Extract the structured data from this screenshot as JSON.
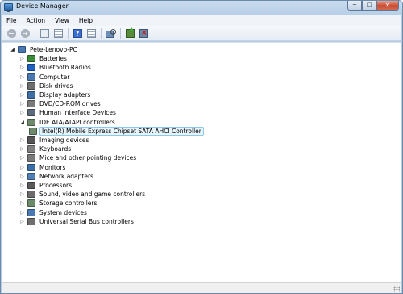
{
  "window": {
    "title": "Device Manager"
  },
  "menu": [
    "File",
    "Action",
    "View",
    "Help"
  ],
  "toolbar": {
    "buttons": [
      "back-icon",
      "forward-icon",
      "show-hide-tree-icon",
      "properties-icon",
      "help-icon",
      "view-icon",
      "scan-hardware-icon",
      "update-driver-icon",
      "uninstall-icon"
    ]
  },
  "tree": {
    "root": "Pete-Lenovo-PC",
    "items": [
      {
        "label": "Batteries",
        "icon": "battery-icon",
        "color": "#3a8a3a"
      },
      {
        "label": "Bluetooth Radios",
        "icon": "bluetooth-icon",
        "color": "#1e5fc0"
      },
      {
        "label": "Computer",
        "icon": "computer-icon",
        "color": "#4a78b0"
      },
      {
        "label": "Disk drives",
        "icon": "disk-drive-icon",
        "color": "#6d6d6d"
      },
      {
        "label": "Display adapters",
        "icon": "display-adapter-icon",
        "color": "#3f6fa3"
      },
      {
        "label": "DVD/CD-ROM drives",
        "icon": "dvd-drive-icon",
        "color": "#7a7a7a"
      },
      {
        "label": "Human Interface Devices",
        "icon": "hid-icon",
        "color": "#5b6b7b"
      },
      {
        "label": "IDE ATA/ATAPI controllers",
        "icon": "ide-controller-icon",
        "color": "#6e8b6e",
        "expanded": true
      },
      {
        "label": "Intel(R) Mobile Express Chipset SATA AHCI Controller",
        "icon": "controller-icon",
        "color": "#6e8b6e",
        "child": true,
        "selected": true
      },
      {
        "label": "Imaging devices",
        "icon": "camera-icon",
        "color": "#555555"
      },
      {
        "label": "Keyboards",
        "icon": "keyboard-icon",
        "color": "#808080"
      },
      {
        "label": "Mice and other pointing devices",
        "icon": "mouse-icon",
        "color": "#7a7a7a"
      },
      {
        "label": "Monitors",
        "icon": "monitor-icon",
        "color": "#3c6ea8"
      },
      {
        "label": "Network adapters",
        "icon": "network-adapter-icon",
        "color": "#4f7fb3"
      },
      {
        "label": "Processors",
        "icon": "processor-icon",
        "color": "#5a5a5a"
      },
      {
        "label": "Sound, video and game controllers",
        "icon": "sound-icon",
        "color": "#6b6b6b"
      },
      {
        "label": "Storage controllers",
        "icon": "storage-controller-icon",
        "color": "#6a8a6a"
      },
      {
        "label": "System devices",
        "icon": "system-device-icon",
        "color": "#4a78b0"
      },
      {
        "label": "Universal Serial Bus controllers",
        "icon": "usb-icon",
        "color": "#6e6e6e"
      }
    ]
  }
}
